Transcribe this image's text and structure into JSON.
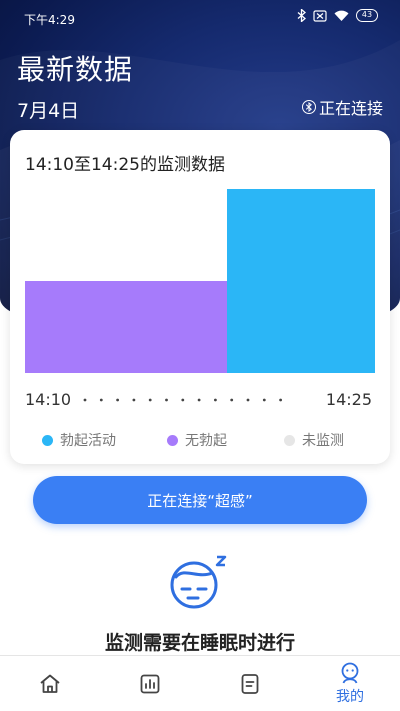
{
  "status_bar": {
    "time": "下午4:29",
    "battery": "43"
  },
  "header": {
    "title": "最新数据",
    "date": "7月4日",
    "connection_status": "正在连接"
  },
  "card": {
    "title": "14:10至14:25的监测数据",
    "start_time": "14:10",
    "end_time": "14:25",
    "legend": [
      {
        "label": "勃起活动",
        "color": "#2bb6f6"
      },
      {
        "label": "无勃起",
        "color": "#a67bfb"
      },
      {
        "label": "未监测",
        "color": "#e6e6e6"
      }
    ]
  },
  "chart_data": {
    "type": "bar",
    "categories": [
      "无勃起",
      "勃起活动"
    ],
    "values": [
      0.5,
      1.0
    ],
    "colors": [
      "#a67bfb",
      "#2bb6f6"
    ],
    "x_range": [
      "14:10",
      "14:25"
    ]
  },
  "connect_button": {
    "label": "正在连接“超感”"
  },
  "sleep_hint": {
    "text": "监测需要在睡眠时进行"
  },
  "tabbar": {
    "tabs": [
      {
        "icon": "home-icon"
      },
      {
        "icon": "chart-icon"
      },
      {
        "icon": "document-icon"
      },
      {
        "icon": "profile-icon",
        "label": "我的"
      }
    ]
  }
}
